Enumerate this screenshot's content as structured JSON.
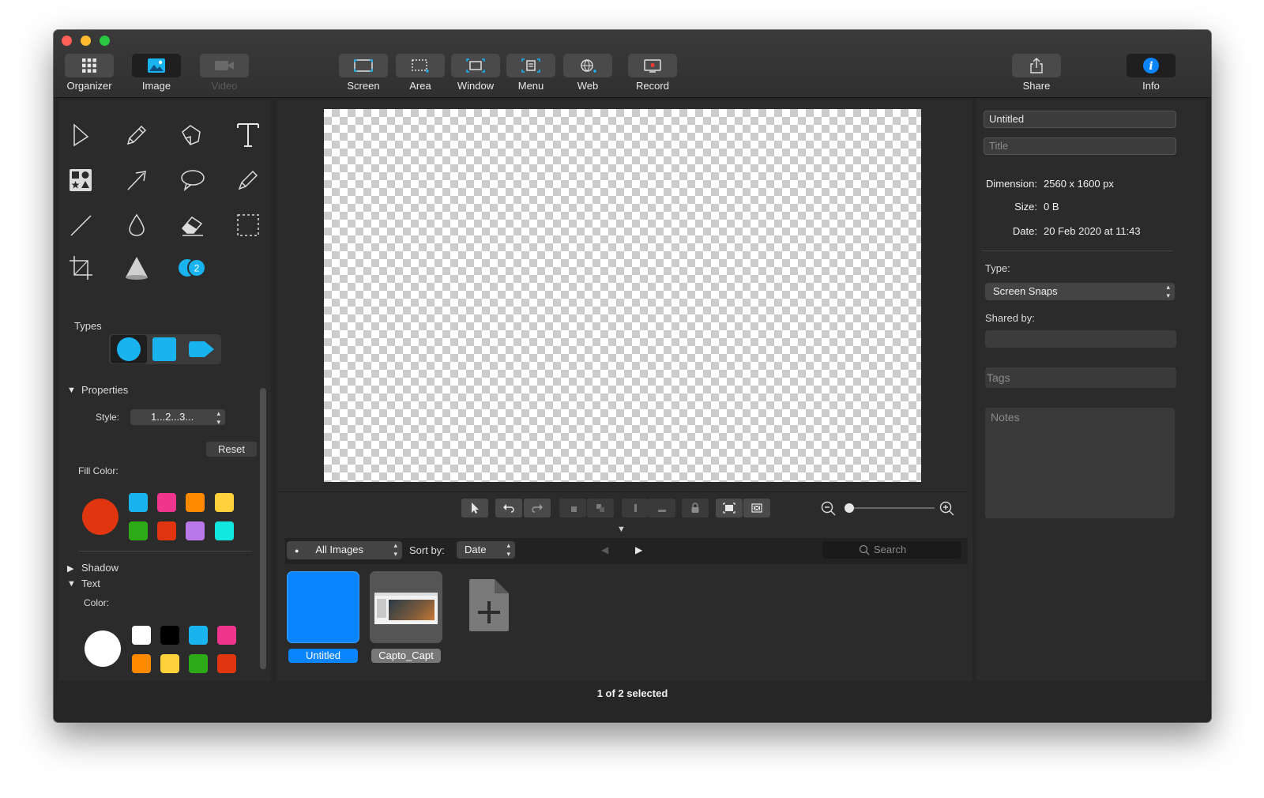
{
  "colors": {
    "accent": "#0a84ff",
    "cyan": "#19b4f0",
    "window_bg": "#262626",
    "panel_bg": "#2b2b2b",
    "close": "#ff5f57",
    "minimize": "#febc2e",
    "zoom": "#28c840"
  },
  "toolbar": {
    "left_tabs": [
      {
        "label": "Organizer",
        "icon": "grid-icon"
      },
      {
        "label": "Image",
        "icon": "image-icon"
      },
      {
        "label": "Video",
        "icon": "video-icon"
      }
    ],
    "capture": [
      {
        "label": "Screen",
        "icon": "screen-capture-icon"
      },
      {
        "label": "Area",
        "icon": "area-capture-icon"
      },
      {
        "label": "Window",
        "icon": "window-capture-icon"
      },
      {
        "label": "Menu",
        "icon": "menu-capture-icon"
      },
      {
        "label": "Web",
        "icon": "web-capture-icon"
      },
      {
        "label": "Record",
        "icon": "record-icon"
      }
    ],
    "share_label": "Share",
    "info_label": "Info"
  },
  "tools": {
    "icons": [
      "pointer-icon",
      "pencil-icon",
      "highlighter-icon",
      "text-tool-icon",
      "stamp-icon",
      "arrow-tool-icon",
      "speech-bubble-icon",
      "marker-icon",
      "line-tool-icon",
      "blur-drop-icon",
      "eraser-icon",
      "selection-icon",
      "crop-icon",
      "spotlight-icon",
      "numbering-icon"
    ],
    "numbering_badge": "2",
    "types_label": "Types",
    "properties_label": "Properties",
    "style_label": "Style:",
    "style_value": "1...2...3...",
    "reset_label": "Reset",
    "fill_color_label": "Fill Color:",
    "fill_selected": "#e0350e",
    "fill_swatches": [
      "#19b4f0",
      "#f0358f",
      "#ff8a00",
      "#ffd23c",
      "#2eaa18",
      "#e0350e",
      "#b878e8",
      "#13e8e0"
    ],
    "shadow_label": "Shadow",
    "text_label": "Text",
    "text_color_label": "Color:",
    "text_selected": "#ffffff",
    "text_swatches": [
      "#ffffff",
      "#000000",
      "#19b4f0",
      "#f0358f",
      "#ff8a00",
      "#ffd23c",
      "#2eaa18",
      "#e0350e"
    ]
  },
  "library": {
    "filter": "All Images",
    "sort_label": "Sort by:",
    "sort_value": "Date",
    "search_placeholder": "Search",
    "items": [
      {
        "name": "Untitled",
        "selected": true
      },
      {
        "name": "Capto_Capt",
        "selected": false
      }
    ]
  },
  "info": {
    "name_value": "Untitled",
    "title_placeholder": "Title",
    "dimension_label": "Dimension:",
    "dimension_value": "2560 x 1600 px",
    "size_label": "Size:",
    "size_value": "0 B",
    "date_label": "Date:",
    "date_value": "20 Feb 2020 at 11:43",
    "type_label": "Type:",
    "type_value": "Screen Snaps",
    "shared_label": "Shared by:",
    "tags_placeholder": "Tags",
    "notes_placeholder": "Notes"
  },
  "status": "1 of 2 selected"
}
